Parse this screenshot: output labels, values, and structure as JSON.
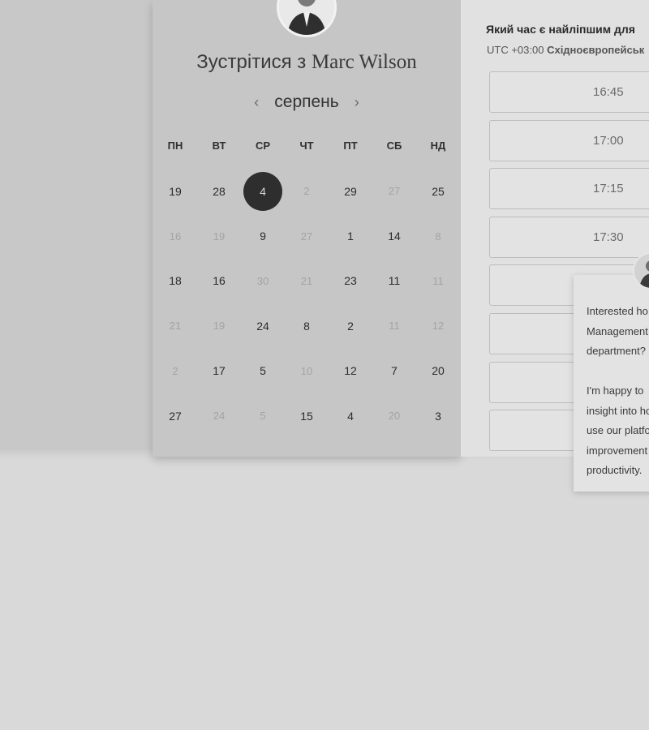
{
  "meeting": {
    "title_prefix": "Зустрітися з",
    "host_name": "Marc Wilson"
  },
  "calendar": {
    "month_label": "серпень",
    "prev_icon": "‹",
    "next_icon": "›",
    "weekdays": [
      "ПН",
      "ВТ",
      "СР",
      "ЧТ",
      "ПТ",
      "СБ",
      "НД"
    ],
    "days": [
      {
        "label": "19",
        "muted": false
      },
      {
        "label": "28",
        "muted": false
      },
      {
        "label": "4",
        "muted": false,
        "selected": true
      },
      {
        "label": "2",
        "muted": true
      },
      {
        "label": "29",
        "muted": false
      },
      {
        "label": "27",
        "muted": true
      },
      {
        "label": "25",
        "muted": false
      },
      {
        "label": "16",
        "muted": true
      },
      {
        "label": "19",
        "muted": true
      },
      {
        "label": "9",
        "muted": false
      },
      {
        "label": "27",
        "muted": true
      },
      {
        "label": "1",
        "muted": false
      },
      {
        "label": "14",
        "muted": false
      },
      {
        "label": "8",
        "muted": true
      },
      {
        "label": "18",
        "muted": false
      },
      {
        "label": "16",
        "muted": false
      },
      {
        "label": "30",
        "muted": true
      },
      {
        "label": "21",
        "muted": true
      },
      {
        "label": "23",
        "muted": false
      },
      {
        "label": "11",
        "muted": false
      },
      {
        "label": "11",
        "muted": true
      },
      {
        "label": "21",
        "muted": true
      },
      {
        "label": "19",
        "muted": true
      },
      {
        "label": "24",
        "muted": false
      },
      {
        "label": "8",
        "muted": false
      },
      {
        "label": "2",
        "muted": false
      },
      {
        "label": "11",
        "muted": true
      },
      {
        "label": "12",
        "muted": true
      },
      {
        "label": "2",
        "muted": true
      },
      {
        "label": "17",
        "muted": false
      },
      {
        "label": "5",
        "muted": false
      },
      {
        "label": "10",
        "muted": true
      },
      {
        "label": "12",
        "muted": false
      },
      {
        "label": "7",
        "muted": false
      },
      {
        "label": "20",
        "muted": false
      },
      {
        "label": "27",
        "muted": false
      },
      {
        "label": "24",
        "muted": true
      },
      {
        "label": "5",
        "muted": true
      },
      {
        "label": "15",
        "muted": false
      },
      {
        "label": "4",
        "muted": false
      },
      {
        "label": "20",
        "muted": true
      },
      {
        "label": "3",
        "muted": false
      }
    ]
  },
  "times": {
    "heading": "Який час є найліпшим для",
    "tz_offset": "UTC +03:00",
    "tz_name": "Східноєвропейськ",
    "slots": [
      "16:45",
      "17:00",
      "17:15",
      "17:30",
      "",
      "",
      "",
      ""
    ]
  },
  "chat": {
    "lines": [
      "Interested ho",
      "Management",
      "department?",
      "",
      "I'm happy to",
      "insight into ho",
      "use our platfo",
      "improvement",
      "productivity."
    ]
  }
}
